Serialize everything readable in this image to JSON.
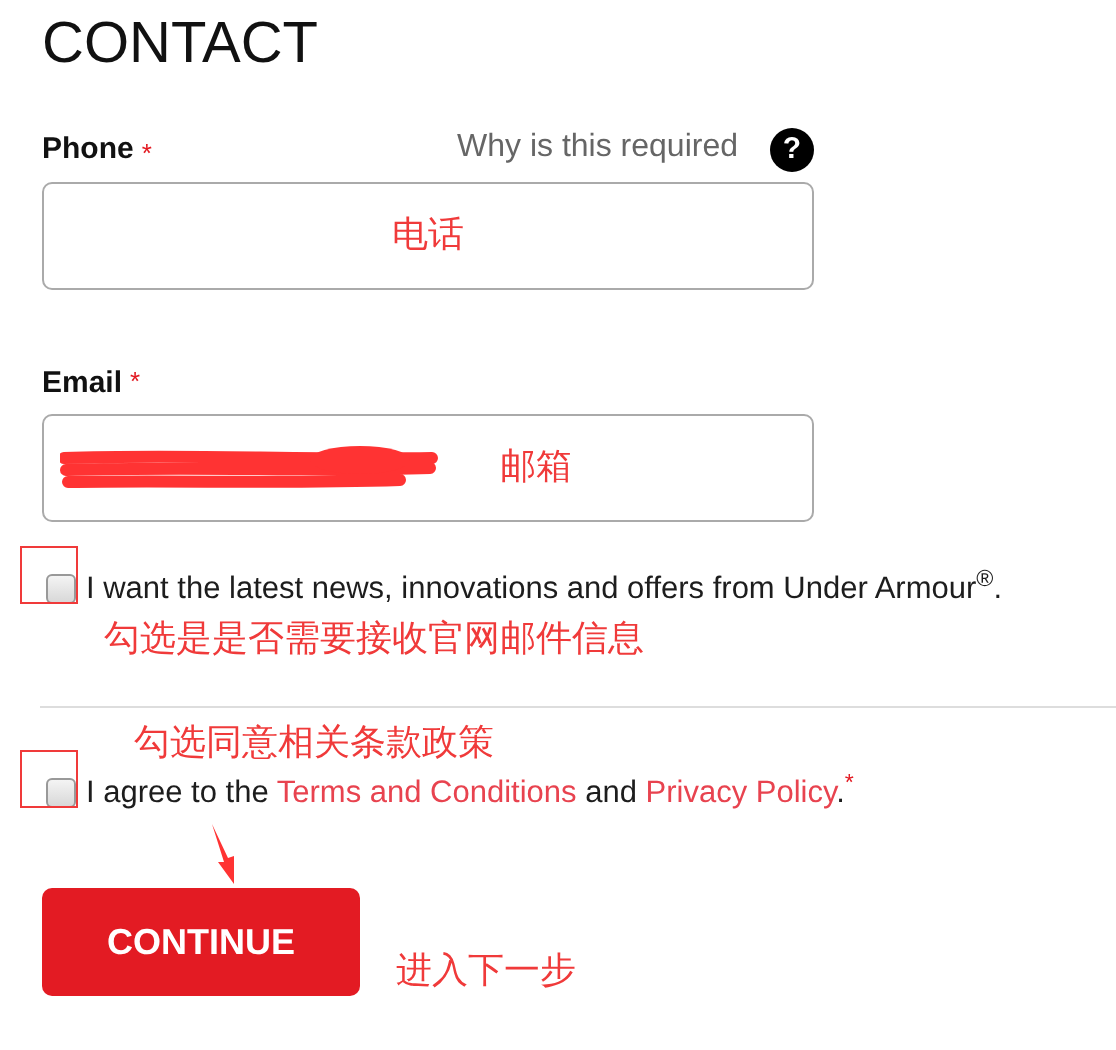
{
  "heading": "CONTACT",
  "phone": {
    "label": "Phone",
    "required_mark": "*",
    "help_text": "Why is this required",
    "help_icon": "?",
    "annotation": "电话"
  },
  "email": {
    "label": "Email",
    "required_mark": "*",
    "redacted": true,
    "annotation": "邮箱"
  },
  "newsletter": {
    "checked": false,
    "highlighted": true,
    "label": "I want the latest news, innovations and offers from Under Armour$^{®}$.",
    "annotation": "勾选是是否需要接收官网邮件信息"
  },
  "terms": {
    "checked": false,
    "highlighted": true,
    "annotation": "勾选同意相关条款政策",
    "arrow": true,
    "required_mark": "*",
    "segments": [
      {
        "kind": "text",
        "text": "I agree to the "
      },
      {
        "kind": "link",
        "text": "Terms and Conditions"
      },
      {
        "kind": "text",
        "text": " and "
      },
      {
        "kind": "link",
        "text": "Privacy Policy"
      },
      {
        "kind": "text",
        "text": "."
      }
    ]
  },
  "continue": {
    "label": "CONTINUE",
    "annotation": "进入下一步"
  }
}
